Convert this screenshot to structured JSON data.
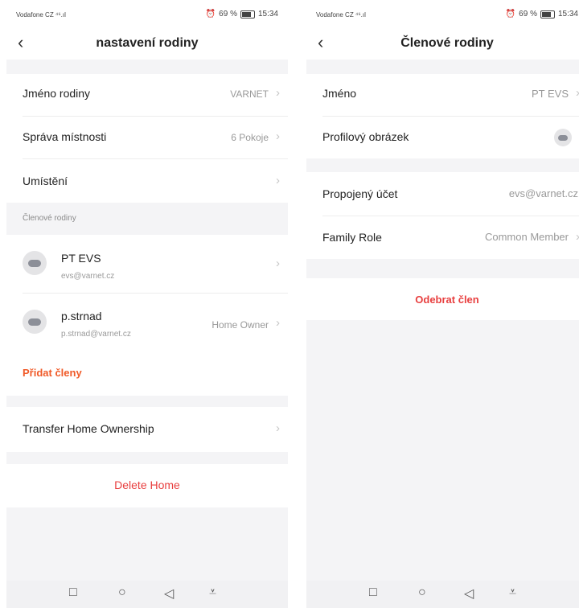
{
  "left": {
    "status": {
      "carrier": "Vodafone CZ ⁴⁶.ıl",
      "right": "69 %",
      "time": "15:34"
    },
    "header": {
      "title": "nastavení rodiny"
    },
    "rows": {
      "family_name": {
        "label": "Jméno rodiny",
        "value": "VARNET"
      },
      "rooms": {
        "label": "Správa místnosti",
        "value": "6 Pokoje"
      },
      "location": {
        "label": "Umístění",
        "value": ""
      }
    },
    "members_section_label": "Členové rodiny",
    "members": [
      {
        "name": "PT EVS",
        "email": "evs@varnet.cz",
        "role": ""
      },
      {
        "name": "p.strnad",
        "email": "p.strnad@varnet.cz",
        "role": "Home Owner"
      }
    ],
    "add_member": "Přidat členy",
    "transfer": "Transfer Home Ownership",
    "delete_home": "Delete Home"
  },
  "right": {
    "status": {
      "carrier": "Vodafone CZ ⁴⁶.ıl",
      "right": "69 %",
      "time": "15:34"
    },
    "header": {
      "title": "Členové rodiny"
    },
    "rows": {
      "name": {
        "label": "Jméno",
        "value": "PT EVS"
      },
      "avatar": {
        "label": "Profilový obrázek"
      },
      "linked": {
        "label": "Propojený účet",
        "value": "evs@varnet.cz"
      },
      "role": {
        "label": "Family Role",
        "value": "Common Member"
      }
    },
    "remove_member": "Odebrat člen"
  },
  "icons": {
    "back": "‹",
    "chevron": "›",
    "nav_square": "□",
    "nav_circle": "○",
    "nav_back": "◁",
    "nav_menu": "⩡"
  },
  "colors": {
    "accent_orange": "#f05a28",
    "danger_red": "#e83f3f"
  }
}
